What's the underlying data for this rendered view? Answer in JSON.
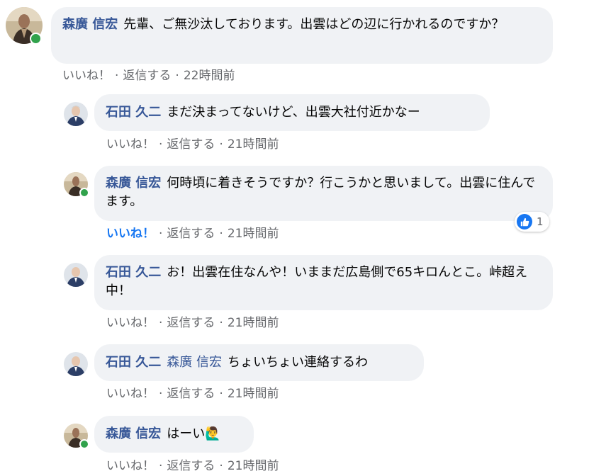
{
  "comments": [
    {
      "author": "森廣 信宏",
      "text": "先輩、ご無沙汰しております。出雲はどの辺に行かれるのですか？",
      "actions": {
        "like": "いいね！",
        "reply": "返信する",
        "time": "22時間前"
      }
    },
    {
      "author": "石田 久二",
      "text": "まだ決まってないけど、出雲大社付近かなー",
      "actions": {
        "like": "いいね！",
        "reply": "返信する",
        "time": "21時間前"
      }
    },
    {
      "author": "森廣 信宏",
      "text": "何時頃に着きそうですか？行こうかと思いまして。出雲に住んでます。",
      "actions": {
        "like": "いいね！",
        "reply": "返信する",
        "time": "21時間前"
      },
      "reaction_count": "1"
    },
    {
      "author": "石田 久二",
      "text": "お！出雲在住なんや！いままだ広島側で65キロんとこ。峠超え中！",
      "actions": {
        "like": "いいね！",
        "reply": "返信する",
        "time": "21時間前"
      }
    },
    {
      "author": "石田 久二",
      "mention": "森廣 信宏",
      "text": "ちょいちょい連絡するわ",
      "actions": {
        "like": "いいね！",
        "reply": "返信する",
        "time": "21時間前"
      }
    },
    {
      "author": "森廣 信宏",
      "text": "はーい",
      "emoji": "🙋‍♂️",
      "actions": {
        "like": "いいね！",
        "reply": "返信する",
        "time": "21時間前"
      }
    }
  ],
  "separator": "·",
  "colors": {
    "bubble": "#f0f2f5",
    "author": "#385898",
    "meta": "#65676b",
    "liked": "#1877f2",
    "online": "#31a24c"
  },
  "icons": {
    "online": "online-status-dot",
    "reaction": "like-thumb-icon"
  }
}
